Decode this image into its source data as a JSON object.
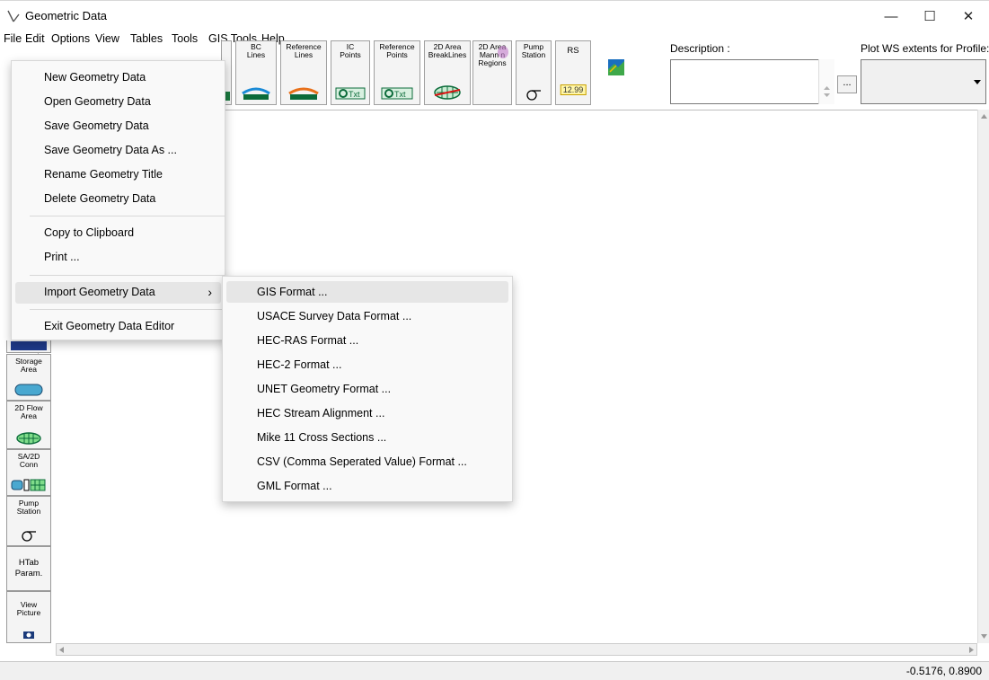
{
  "window": {
    "title": "Geometric Data",
    "minimize": "—",
    "maximize": "☐",
    "close": "✕"
  },
  "menubar": [
    "File",
    "Edit",
    "Options",
    "View",
    "Tables",
    "Tools",
    "GIS Tools",
    "Help"
  ],
  "toolbar": {
    "buttons": [
      {
        "label": "BC\nLines"
      },
      {
        "label": "Reference\nLines"
      },
      {
        "label": "IC\nPoints"
      },
      {
        "label": "Reference\nPoints"
      },
      {
        "label": "2D Area\nBreakLines"
      },
      {
        "label": "2D Area\nMann n\nRegions"
      },
      {
        "label": "Pump\nStation"
      },
      {
        "label": "RS"
      }
    ],
    "rs_value": "12.99",
    "description_label": "Description :",
    "description_more": "...",
    "plot_ws_label": "Plot WS extents for Profile:"
  },
  "left_tools": [
    {
      "label": "Storage\nArea"
    },
    {
      "label": "2D Flow\nArea"
    },
    {
      "label": "SA/2D\nConn"
    },
    {
      "label": "Pump\nStation"
    },
    {
      "label": "HTab\nParam."
    },
    {
      "label": "View\nPicture"
    }
  ],
  "file_menu": {
    "items": [
      "New Geometry Data",
      "Open Geometry Data",
      "Save Geometry Data",
      "Save Geometry Data As ...",
      "Rename Geometry Title",
      "Delete Geometry Data",
      "Copy to Clipboard",
      "Print ...",
      "Import Geometry Data",
      "Exit Geometry Data Editor"
    ],
    "submenu_arrow": "›"
  },
  "import_submenu": {
    "items": [
      "GIS Format ...",
      "USACE Survey Data Format ...",
      "HEC-RAS Format ...",
      "HEC-2 Format ...",
      "UNET Geometry Format ...",
      "HEC Stream Alignment ...",
      "Mike 11 Cross Sections ...",
      "CSV (Comma Seperated Value) Format ...",
      "GML Format ..."
    ]
  },
  "status": {
    "coordinates": "-0.5176, 0.8900"
  },
  "colors": {
    "menu_bg": "#f9f9f9",
    "highlight": "#e6e6e6",
    "toolbar_bg": "#f4f4f4"
  }
}
